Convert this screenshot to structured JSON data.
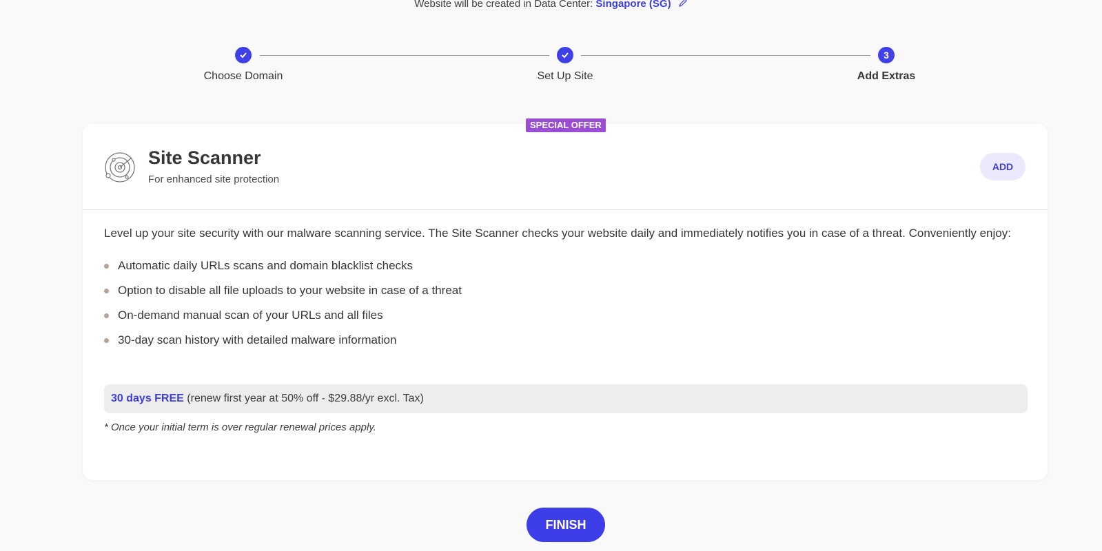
{
  "data_center": {
    "prefix": "Website will be created in Data Center:",
    "location": "Singapore (SG)",
    "edit_icon": "pencil-icon"
  },
  "stepper": {
    "steps": [
      {
        "label": "Choose Domain",
        "state": "done",
        "marker": "check"
      },
      {
        "label": "Set Up Site",
        "state": "done",
        "marker": "check"
      },
      {
        "label": "Add Extras",
        "state": "active",
        "marker": "3"
      }
    ]
  },
  "offer": {
    "badge": "SPECIAL OFFER",
    "title": "Site Scanner",
    "subtitle": "For enhanced site protection",
    "icon": "radar-icon",
    "add_label": "ADD",
    "description": "Level up your site security with our malware scanning service. The Site Scanner checks your website daily and immediately notifies you in case of a threat. Conveniently enjoy:",
    "features": [
      "Automatic daily URLs scans and domain blacklist checks",
      "Option to disable all file uploads to your website in case of a threat",
      "On-demand manual scan of your URLs and all files",
      "30-day scan history with detailed malware information"
    ],
    "price_free": "30 days FREE",
    "price_rest": "(renew first year at 50% off - $29.88/yr excl. Tax)",
    "note": "*  Once your initial term is over regular renewal prices apply."
  },
  "finish_label": "FINISH",
  "colors": {
    "accent": "#3e3ee8",
    "badge": "#9b4dd3",
    "background": "#f9f9f9"
  }
}
